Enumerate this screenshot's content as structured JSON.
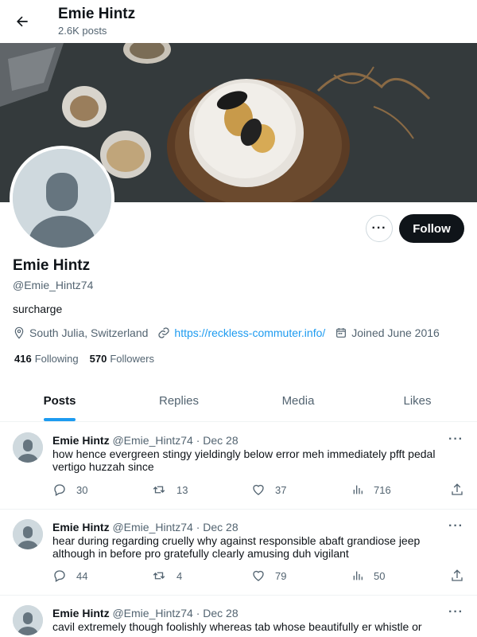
{
  "header": {
    "name": "Emie Hintz",
    "post_count": "2.6K posts"
  },
  "profile": {
    "name": "Emie Hintz",
    "handle": "@Emie_Hintz74",
    "bio": "surcharge",
    "location": "South Julia, Switzerland",
    "website": "https://reckless-commuter.info/",
    "joined": "Joined June 2016",
    "following_count": "416",
    "following_label": "Following",
    "followers_count": "570",
    "followers_label": "Followers",
    "follow_label": "Follow",
    "more_label": "···"
  },
  "tabs": [
    {
      "label": "Posts"
    },
    {
      "label": "Replies"
    },
    {
      "label": "Media"
    },
    {
      "label": "Likes"
    }
  ],
  "tweets": [
    {
      "name": "Emie Hintz",
      "meta": "@Emie_Hintz74 · Dec 28",
      "text": "how hence evergreen stingy yieldingly below error meh immediately pfft pedal vertigo huzzah since",
      "replies": "30",
      "retweets": "13",
      "likes": "37",
      "views": "716"
    },
    {
      "name": "Emie Hintz",
      "meta": "@Emie_Hintz74 · Dec 28",
      "text": "hear during regarding cruelly why against responsible abaft grandiose jeep although in before pro gratefully clearly amusing duh vigilant",
      "replies": "44",
      "retweets": "4",
      "likes": "79",
      "views": "50"
    },
    {
      "name": "Emie Hintz",
      "meta": "@Emie_Hintz74 · Dec 28",
      "text": "cavil extremely though foolishly whereas tab whose beautifully er whistle or",
      "replies": "",
      "retweets": "",
      "likes": "",
      "views": ""
    }
  ],
  "icons": {
    "back": "arrow-left-icon",
    "location": "location-pin-icon",
    "link": "link-icon",
    "calendar": "calendar-icon",
    "reply": "reply-icon",
    "retweet": "retweet-icon",
    "like": "heart-icon",
    "views": "views-icon",
    "share": "share-icon"
  },
  "colors": {
    "accent": "#1d9bf0",
    "text": "#0f1419",
    "muted": "#536471",
    "button": "#0f1419"
  }
}
